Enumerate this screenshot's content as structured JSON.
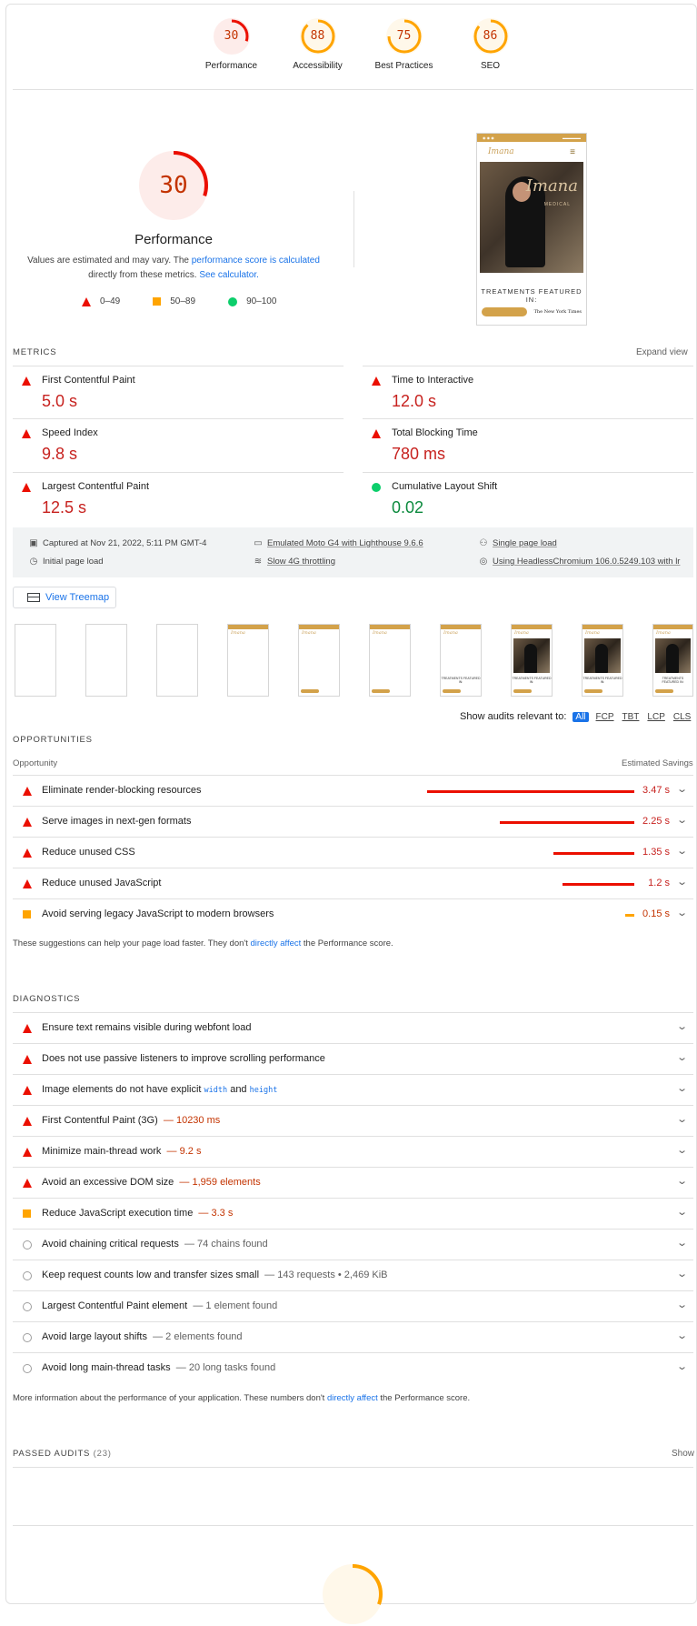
{
  "colors": {
    "fail": "#eb0f00",
    "average": "#ffa400",
    "pass": "#0cce6b",
    "link": "#1a73e8",
    "brand_gold": "#d3a24a"
  },
  "top_gauges": [
    {
      "score": "30",
      "label": "Performance",
      "rating": "fail"
    },
    {
      "score": "88",
      "label": "Accessibility",
      "rating": "average"
    },
    {
      "score": "75",
      "label": "Best Practices",
      "rating": "average"
    },
    {
      "score": "86",
      "label": "SEO",
      "rating": "average"
    }
  ],
  "performance": {
    "score": "30",
    "title": "Performance",
    "desc_1": "Values are estimated and may vary. The ",
    "desc_link_1": "performance score is calculated",
    "desc_2": " directly from these metrics. ",
    "desc_link_2": "See calculator.",
    "legend": [
      "0–49",
      "50–89",
      "90–100"
    ]
  },
  "screenshot": {
    "brand": "Imana",
    "brand_sub": "MEDICAL",
    "treatments": "TREATMENTS FEATURED IN:",
    "press": "The New York Times"
  },
  "metrics": {
    "header": "Metrics",
    "expand": "Expand view",
    "items": [
      {
        "label": "First Contentful Paint",
        "value": "5.0 s",
        "rating": "fail"
      },
      {
        "label": "Time to Interactive",
        "value": "12.0 s",
        "rating": "fail"
      },
      {
        "label": "Speed Index",
        "value": "9.8 s",
        "rating": "fail"
      },
      {
        "label": "Total Blocking Time",
        "value": "780 ms",
        "rating": "fail"
      },
      {
        "label": "Largest Contentful Paint",
        "value": "12.5 s",
        "rating": "fail"
      },
      {
        "label": "Cumulative Layout Shift",
        "value": "0.02",
        "rating": "pass"
      }
    ]
  },
  "runtime": {
    "captured": "Captured at Nov 21, 2022, 5:11 PM GMT-4",
    "initial": "Initial page load",
    "device": "Emulated Moto G4 with Lighthouse 9.6.6",
    "throttle": "Slow 4G throttling",
    "session": "Single page load",
    "browser": "Using HeadlessChromium 106.0.5249.103 with lr"
  },
  "treemap": {
    "label": "View Treemap"
  },
  "filter": {
    "label": "Show audits relevant to:",
    "chips": [
      "All",
      "FCP",
      "TBT",
      "LCP",
      "CLS"
    ]
  },
  "opportunities": {
    "header": "Opportunities",
    "col_left": "Opportunity",
    "col_right": "Estimated Savings",
    "items": [
      {
        "title": "Eliminate render-blocking resources",
        "savings": "3.47 s",
        "seconds": 3.47,
        "rating": "fail"
      },
      {
        "title": "Serve images in next-gen formats",
        "savings": "2.25 s",
        "seconds": 2.25,
        "rating": "fail"
      },
      {
        "title": "Reduce unused CSS",
        "savings": "1.35 s",
        "seconds": 1.35,
        "rating": "fail"
      },
      {
        "title": "Reduce unused JavaScript",
        "savings": "1.2 s",
        "seconds": 1.2,
        "rating": "fail"
      },
      {
        "title": "Avoid serving legacy JavaScript to modern browsers",
        "savings": "0.15 s",
        "seconds": 0.15,
        "rating": "average"
      }
    ],
    "note_1": "These suggestions can help your page load faster. They don't ",
    "note_link": "directly affect",
    "note_2": " the Performance score."
  },
  "diagnostics": {
    "header": "Diagnostics",
    "items": [
      {
        "title": "Ensure text remains visible during webfont load",
        "display": "",
        "rating": "fail"
      },
      {
        "title": "Does not use passive listeners to improve scrolling performance",
        "display": "",
        "rating": "fail"
      },
      {
        "title_pre": "Image elements do not have explicit ",
        "code_1": "width",
        "title_mid": " and ",
        "code_2": "height",
        "rating": "fail"
      },
      {
        "title": "First Contentful Paint (3G)",
        "display": "10230 ms",
        "rating": "fail"
      },
      {
        "title": "Minimize main-thread work",
        "display": "9.2 s",
        "rating": "fail"
      },
      {
        "title": "Avoid an excessive DOM size",
        "display": "1,959 elements",
        "rating": "fail"
      },
      {
        "title": "Reduce JavaScript execution time",
        "display": "3.3 s",
        "rating": "average"
      },
      {
        "title": "Avoid chaining critical requests",
        "display": "74 chains found",
        "rating": "info"
      },
      {
        "title": "Keep request counts low and transfer sizes small",
        "display": "143 requests • 2,469 KiB",
        "rating": "info"
      },
      {
        "title": "Largest Contentful Paint element",
        "display": "1 element found",
        "rating": "info"
      },
      {
        "title": "Avoid large layout shifts",
        "display": "2 elements found",
        "rating": "info"
      },
      {
        "title": "Avoid long main-thread tasks",
        "display": "20 long tasks found",
        "rating": "info"
      }
    ],
    "note_1": "More information about the performance of your application. These numbers don't ",
    "note_link": "directly affect",
    "note_2": " the Performance score."
  },
  "passed": {
    "header": "Passed audits",
    "count": "(23)",
    "show": "Show"
  },
  "bottom_gauge": {
    "rating": "average"
  }
}
